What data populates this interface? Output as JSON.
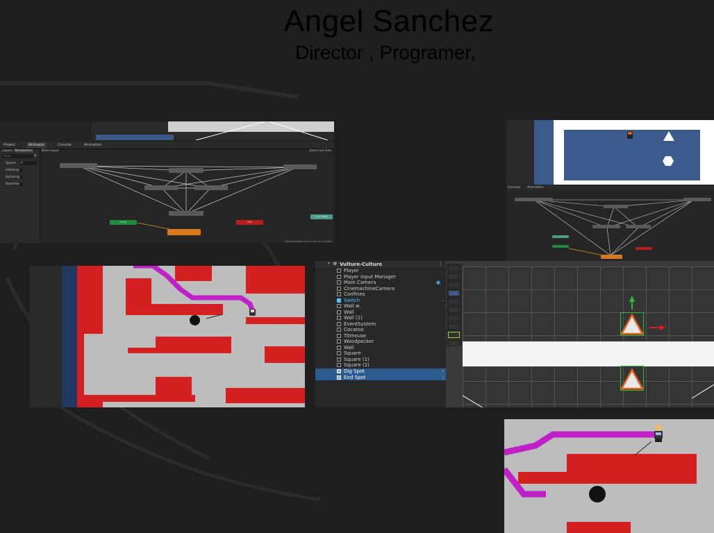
{
  "header": {
    "name": "Angel Sanchez",
    "roles": "Director , Programer,"
  },
  "animator_panel": {
    "tabs": [
      "Project",
      "Animator",
      "Console",
      "Animation"
    ],
    "sub_tabs": [
      "Layers",
      "Parameters"
    ],
    "layer_label": "Base Layer",
    "auto_live_link": "Auto Live Link",
    "search_placeholder": "Name",
    "parameters": [
      {
        "name": "Speed",
        "value": "0"
      },
      {
        "name": "IsSliding",
        "value": ""
      },
      {
        "name": "UpFacing",
        "value": ""
      },
      {
        "name": "DownFac",
        "value": ""
      }
    ],
    "nodes": {
      "entry": "Entry",
      "exit": "Exit",
      "any_state": "Any State"
    },
    "footer_path": "Models/Models AI/Cocatoo AT.controller",
    "colors": {
      "entry": "#1e8a3c",
      "exit": "#b51f1f",
      "default_state": "#d9791c",
      "any_state": "#4f9c8e",
      "state": "#5b5b5b"
    }
  },
  "animator_panel_small": {
    "tabs": [
      "Console",
      "Animation"
    ]
  },
  "hierarchy": {
    "scene_name": "Vulture-Culture",
    "items": [
      {
        "label": "Player",
        "selected": false,
        "cyan": false
      },
      {
        "label": "Player Input Manager",
        "selected": false,
        "cyan": false
      },
      {
        "label": "Main Camera",
        "selected": false,
        "cyan": false
      },
      {
        "label": "CinemachineCamera",
        "selected": false,
        "cyan": false
      },
      {
        "label": "Confines",
        "selected": false,
        "cyan": false
      },
      {
        "label": "Switch",
        "selected": false,
        "cyan": true
      },
      {
        "label": "Wall w",
        "selected": false,
        "cyan": false
      },
      {
        "label": "Wall",
        "selected": false,
        "cyan": false
      },
      {
        "label": "Wall (1)",
        "selected": false,
        "cyan": false
      },
      {
        "label": "EventSystem",
        "selected": false,
        "cyan": false
      },
      {
        "label": "Cocatoo",
        "selected": false,
        "cyan": false
      },
      {
        "label": "Titmouse",
        "selected": false,
        "cyan": false
      },
      {
        "label": "Woodpecker",
        "selected": false,
        "cyan": false
      },
      {
        "label": "Wall",
        "selected": false,
        "cyan": false
      },
      {
        "label": "Square",
        "selected": false,
        "cyan": false
      },
      {
        "label": "Square (1)",
        "selected": false,
        "cyan": false
      },
      {
        "label": "Square (2)",
        "selected": false,
        "cyan": false
      },
      {
        "label": "Dig Spot",
        "selected": true,
        "cyan": false
      },
      {
        "label": "End Spot",
        "selected": true,
        "cyan": false
      }
    ]
  },
  "game_colors": {
    "wall_red": "#d42020",
    "path_magenta": "#c020c8",
    "floor": "#bdbdbd",
    "blue_bg": "#3a5b8c",
    "orange_outline": "#e5641b"
  }
}
